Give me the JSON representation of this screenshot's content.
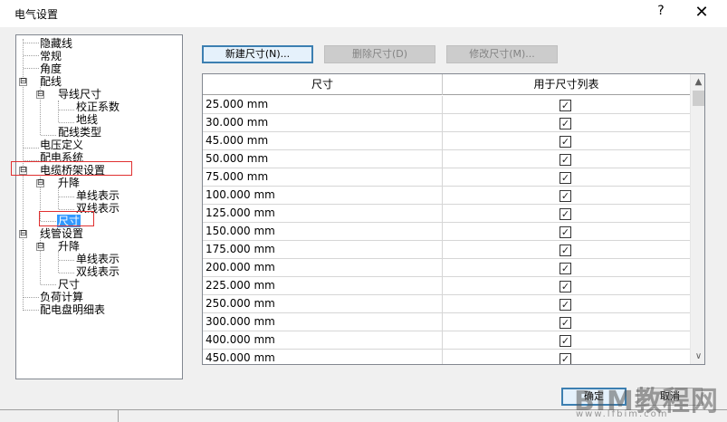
{
  "window": {
    "title": "电气设置",
    "help_label": "?",
    "close_label": "✕"
  },
  "tree": {
    "items": [
      {
        "label": "隐藏线"
      },
      {
        "label": "常规"
      },
      {
        "label": "角度"
      },
      {
        "label": "配线",
        "expander": "⊟"
      },
      {
        "label": "导线尺寸",
        "expander": "⊟"
      },
      {
        "label": "校正系数"
      },
      {
        "label": "地线"
      },
      {
        "label": "配线类型"
      },
      {
        "label": "电压定义"
      },
      {
        "label": "配电系统"
      },
      {
        "label": "电缆桥架设置",
        "expander": "⊟"
      },
      {
        "label": "升降",
        "expander": "⊟"
      },
      {
        "label": "单线表示"
      },
      {
        "label": "双线表示"
      },
      {
        "label": "尺寸",
        "selected": true
      },
      {
        "label": "线管设置",
        "expander": "⊟"
      },
      {
        "label": "升降",
        "expander": "⊟"
      },
      {
        "label": "单线表示"
      },
      {
        "label": "双线表示"
      },
      {
        "label": "尺寸"
      },
      {
        "label": "负荷计算"
      },
      {
        "label": "配电盘明细表"
      }
    ]
  },
  "toolbar": {
    "new_size": "新建尺寸(N)...",
    "delete_size": "删除尺寸(D)",
    "modify_size": "修改尺寸(M)..."
  },
  "grid": {
    "columns": [
      "尺寸",
      "用于尺寸列表"
    ],
    "rows": [
      {
        "size": "25.000 mm",
        "used": true
      },
      {
        "size": "30.000 mm",
        "used": true
      },
      {
        "size": "45.000 mm",
        "used": true
      },
      {
        "size": "50.000 mm",
        "used": true
      },
      {
        "size": "75.000 mm",
        "used": true
      },
      {
        "size": "100.000 mm",
        "used": true
      },
      {
        "size": "125.000 mm",
        "used": true
      },
      {
        "size": "150.000 mm",
        "used": true
      },
      {
        "size": "175.000 mm",
        "used": true
      },
      {
        "size": "200.000 mm",
        "used": true
      },
      {
        "size": "225.000 mm",
        "used": true
      },
      {
        "size": "250.000 mm",
        "used": true
      },
      {
        "size": "300.000 mm",
        "used": true
      },
      {
        "size": "400.000 mm",
        "used": true
      },
      {
        "size": "450.000 mm",
        "used": true
      }
    ],
    "check_glyph": "✓",
    "scroll_up_icon": "▲",
    "scroll_down_icon": "∨"
  },
  "footer": {
    "ok_label": "确定",
    "cancel_label": "取消"
  },
  "watermark": {
    "big": "BIM教程网",
    "small": "www.lfbim.com"
  },
  "colors": {
    "selection": "#3399ff",
    "highlight_box": "#e03030",
    "primary_border": "#3c7fb1"
  }
}
